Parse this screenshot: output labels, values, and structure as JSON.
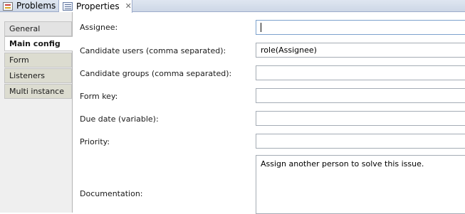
{
  "tabs": [
    {
      "label": "Problems",
      "icon": "problems-icon"
    },
    {
      "label": "Properties",
      "icon": "properties-icon",
      "active": true
    }
  ],
  "sidebar": {
    "items": [
      {
        "label": "General"
      },
      {
        "label": "Main config",
        "active": true
      },
      {
        "label": "Form"
      },
      {
        "label": "Listeners"
      },
      {
        "label": "Multi instance"
      }
    ]
  },
  "form": {
    "assignee": {
      "label": "Assignee:",
      "value": ""
    },
    "candidate_users": {
      "label": "Candidate users (comma separated):",
      "value": "role(Assignee)"
    },
    "candidate_groups": {
      "label": "Candidate groups (comma separated):",
      "value": ""
    },
    "form_key": {
      "label": "Form key:",
      "value": ""
    },
    "due_date": {
      "label": "Due date (variable):",
      "value": ""
    },
    "priority": {
      "label": "Priority:",
      "value": ""
    },
    "documentation": {
      "label": "Documentation:",
      "value": "Assign another person to solve this issue."
    }
  },
  "colors": {
    "tabbar_bg": "#dfe6f1",
    "sidebar_bg": "#efefef",
    "field_border": "#a5acb5"
  }
}
